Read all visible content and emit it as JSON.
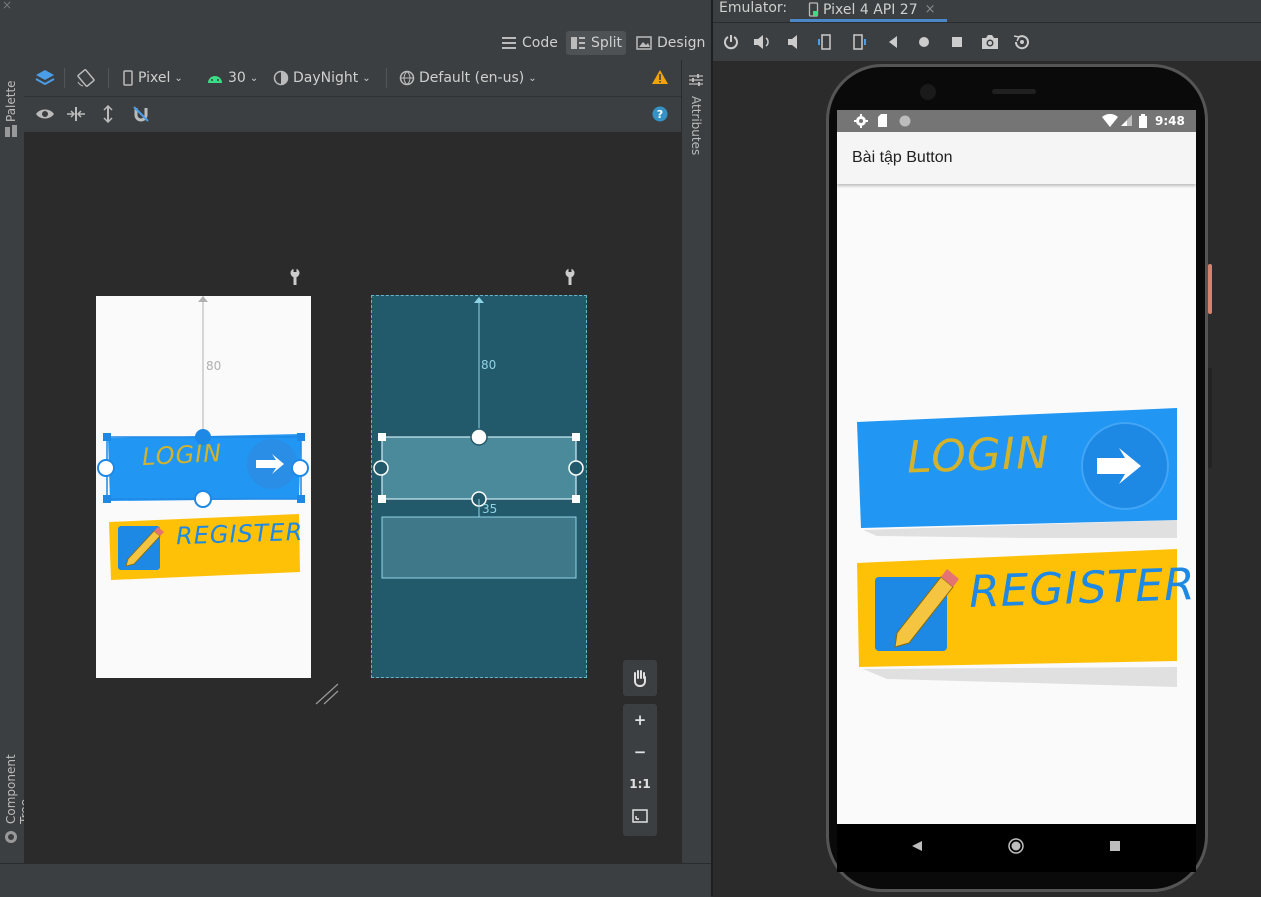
{
  "editor": {
    "modes": {
      "code": "Code",
      "split": "Split",
      "design": "Design"
    },
    "toolbar": {
      "device": "Pixel",
      "api": "30",
      "theme": "DayNight",
      "locale": "Default (en-us)"
    },
    "rails": {
      "palette": "Palette",
      "component_tree": "Component Tree",
      "attributes": "Attributes"
    },
    "constraints": {
      "design_top_margin": "80",
      "blueprint_top_margin": "80",
      "blueprint_gap": "35"
    },
    "design_preview": {
      "login": "LOGIN",
      "register": "REGISTER"
    },
    "zoom": {
      "one_to_one": "1:1"
    }
  },
  "emulator": {
    "label": "Emulator:",
    "tab": "Pixel 4 API 27",
    "status_time": "9:48",
    "app_title": "Bài tập Button",
    "login_text": "LOGIN",
    "register_text": "REGISTER"
  },
  "colors": {
    "accent_blue": "#2196f3",
    "login_text": "#d4b32b",
    "register_yellow": "#ffc107",
    "register_text": "#1e88e5",
    "blueprint": "#225a6b",
    "warning": "#f0a30a"
  }
}
